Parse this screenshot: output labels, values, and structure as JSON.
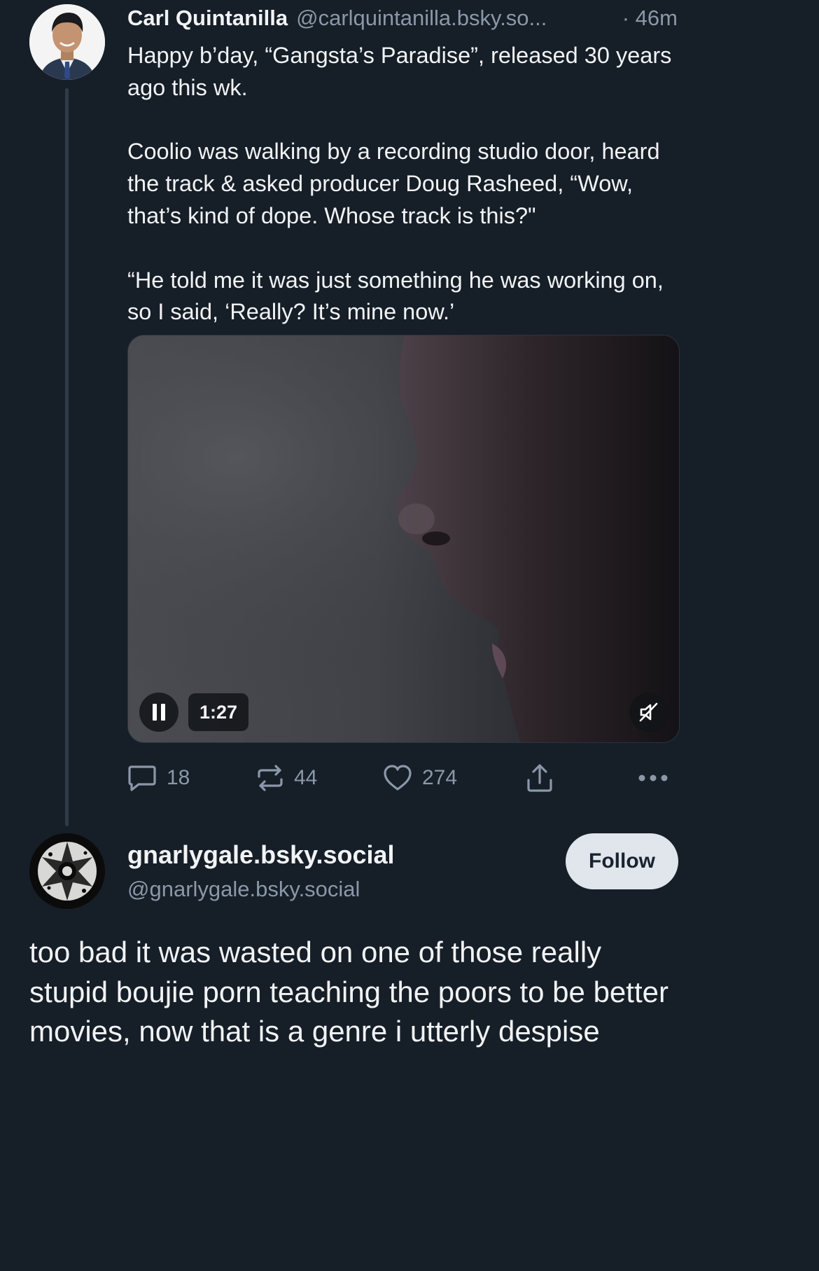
{
  "post": {
    "author_name": "Carl Quintanilla",
    "author_handle": "@carlquintanilla.bsky.so...",
    "time": "· 46m",
    "paragraphs": [
      "Happy b’day, “Gangsta’s Paradise”, released 30 years ago this wk.",
      "Coolio was walking by a recording studio door, heard the track & asked producer Doug Rasheed, “Wow, that’s kind of dope. Whose track is this?\"",
      "“He told me it was just something he was working on, so I said, ‘Really? It’s mine now.’"
    ],
    "video": {
      "time": "1:27",
      "pause_icon": "pause-icon",
      "mute_icon": "speaker-muted-icon"
    },
    "actions": {
      "replies": "18",
      "reposts": "44",
      "likes": "274"
    }
  },
  "reply": {
    "display_name": "gnarlygale.bsky.social",
    "handle": "@gnarlygale.bsky.social",
    "follow_label": "Follow",
    "text": "too bad it was wasted on one of those really stupid boujie porn teaching the poors to be better movies, now that is a genre i utterly despise"
  },
  "colors": {
    "background": "#161e27",
    "text": "#f1f3f5",
    "muted": "#8a98a9",
    "thread_line": "#2e3b4a",
    "follow_bg": "#e1e6ec"
  }
}
